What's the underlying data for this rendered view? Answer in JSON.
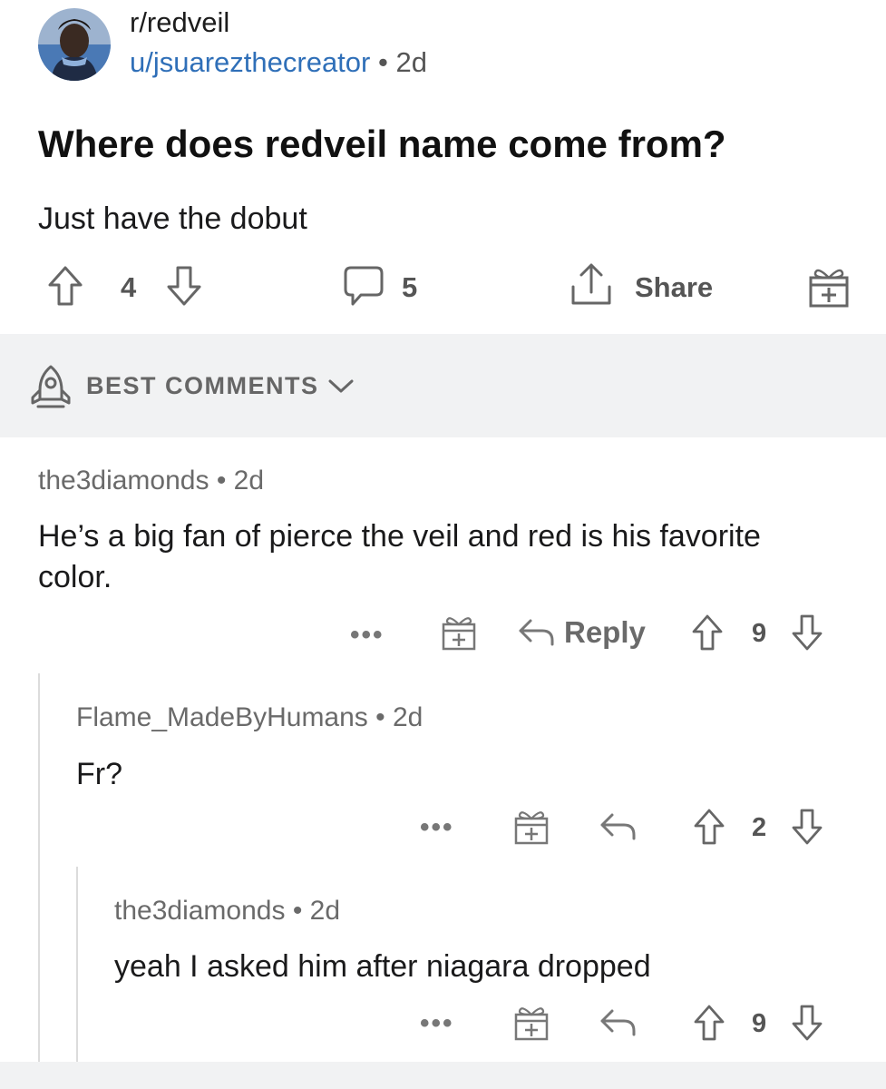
{
  "post": {
    "subreddit": "r/redveil",
    "author": "u/jsuarezthecreator",
    "separator": "•",
    "age": "2d",
    "title": "Where does redveil name come from?",
    "body": "Just have the dobut",
    "upvotes": "4",
    "comments": "5",
    "share_label": "Share"
  },
  "sort": {
    "label": "BEST COMMENTS"
  },
  "comments": [
    {
      "author": "the3diamonds",
      "separator": "•",
      "age": "2d",
      "text": "He’s a big fan of pierce the veil and red is his favorite color.",
      "more": "•••",
      "reply_label": "Reply",
      "votes": "9"
    },
    {
      "author": "Flame_MadeByHumans",
      "separator": "•",
      "age": "2d",
      "text": "Fr?",
      "more": "•••",
      "votes": "2"
    },
    {
      "author": "the3diamonds",
      "separator": "•",
      "age": "2d",
      "text": "yeah I asked him after niagara dropped",
      "more": "•••",
      "votes": "9"
    }
  ],
  "icons": {
    "upvote": "arrow-up-outline",
    "downvote": "arrow-down-outline",
    "comment": "speech-bubble",
    "share": "share-arrow-up",
    "award": "gift-box",
    "sort": "rocket",
    "reply": "reply-arrow"
  },
  "colors": {
    "link": "#2f6fb8",
    "band": "#f1f2f3",
    "icon": "#666666"
  }
}
